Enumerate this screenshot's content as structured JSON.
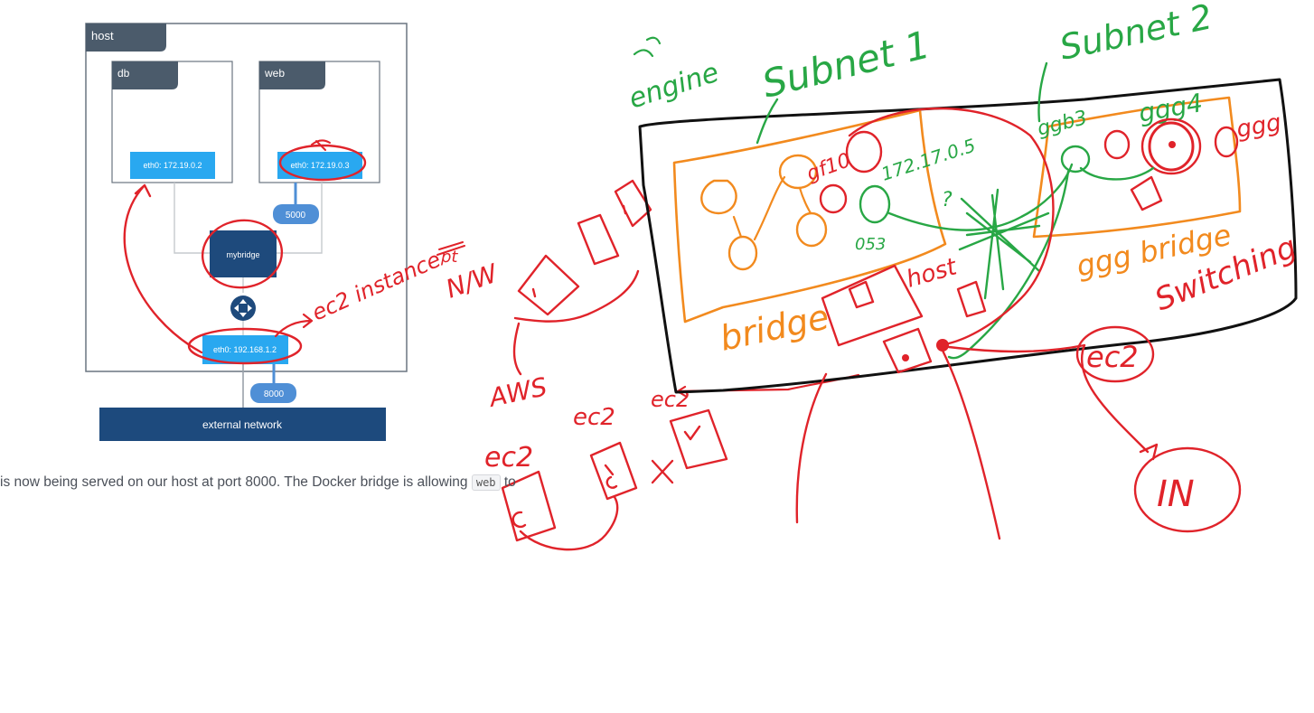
{
  "diagram": {
    "host_label": "host",
    "db_label": "db",
    "web_label": "web",
    "db_eth": "eth0: 172.19.0.2",
    "web_eth": "eth0: 172.19.0.3",
    "web_port": "5000",
    "bridge_label": "mybridge",
    "host_eth": "eth0: 192.168.1.2",
    "host_port": "8000",
    "external_network": "external network"
  },
  "caption": {
    "text_before": "is now being served on our host at port 8000. The Docker bridge is allowing",
    "code": "web",
    "text_after": "to"
  },
  "annotations": {
    "ec2_instance": "ec2 instance",
    "nw": "N/W",
    "strike_word": "pt",
    "aws": "AWS",
    "ec2_a": "ec2",
    "ec2_b": "ec2",
    "ec2_c": "ec2",
    "ec2_circled": "ec2",
    "in": "IN",
    "engine": "engine",
    "subnet1": "Subnet 1",
    "subnet2": "Subnet 2",
    "ip": "172.17.0.5",
    "q_mark": "?",
    "label_053": "053",
    "label_ggb3": "ggb3",
    "label_ggg4": "ggg4",
    "label_ggg": "ggg",
    "label_gf10": "gf10",
    "bridge_word": "bridge",
    "ggg_bridge": "ggg bridge",
    "switching": "Switching",
    "host_word": "host"
  },
  "colors": {
    "dark_header": "#4b5b6b",
    "light_blue_box": "#29a8f0",
    "pill_blue": "#4f8fd6",
    "bridge_navy": "#1e4a7c",
    "external_navy": "#1d4a7d",
    "ink_red": "#e0232a",
    "ink_green": "#28a745",
    "ink_orange": "#f28a1e"
  },
  "icons": [
    "router-icon"
  ]
}
